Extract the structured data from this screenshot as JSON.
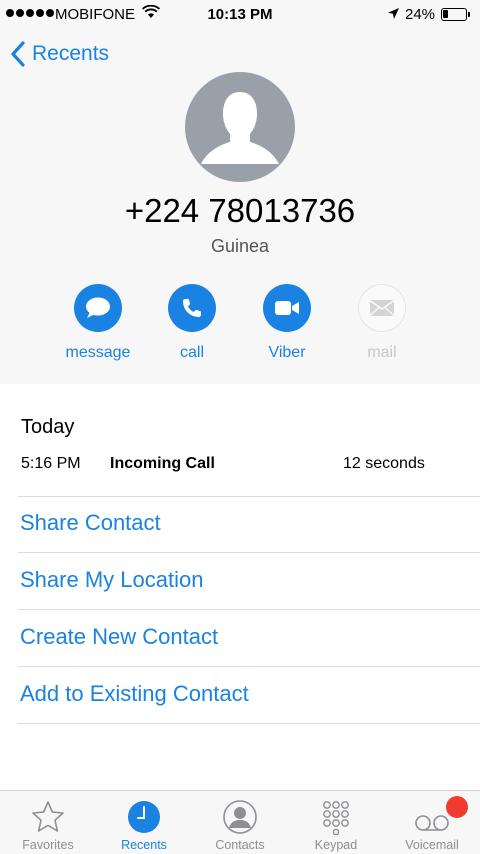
{
  "status_bar": {
    "carrier": "MOBIFONE",
    "time": "10:13 PM",
    "battery": "24%",
    "battery_level": 0.24
  },
  "nav": {
    "back_label": "Recents"
  },
  "contact": {
    "number": "+224 78013736",
    "country": "Guinea"
  },
  "actions": [
    {
      "label": "message",
      "icon": "message-bubble-icon",
      "enabled": true
    },
    {
      "label": "call",
      "icon": "phone-icon",
      "enabled": true
    },
    {
      "label": "Viber",
      "icon": "video-camera-icon",
      "enabled": true
    },
    {
      "label": "mail",
      "icon": "envelope-icon",
      "enabled": false
    }
  ],
  "history": {
    "heading": "Today",
    "entries": [
      {
        "time": "5:16 PM",
        "type": "Incoming Call",
        "duration": "12 seconds"
      }
    ]
  },
  "options": [
    "Share Contact",
    "Share My Location",
    "Create New Contact",
    "Add to Existing Contact"
  ],
  "tabs": [
    {
      "label": "Favorites",
      "icon": "star-icon",
      "active": false
    },
    {
      "label": "Recents",
      "icon": "clock-icon",
      "active": true
    },
    {
      "label": "Contacts",
      "icon": "person-circle-icon",
      "active": false
    },
    {
      "label": "Keypad",
      "icon": "keypad-icon",
      "active": false
    },
    {
      "label": "Voicemail",
      "icon": "voicemail-icon",
      "active": false
    }
  ],
  "colors": {
    "accent": "#1a82e2",
    "badge": "#f23a2e",
    "avatar_bg": "#9aa0a9",
    "inactive_tab": "#8e8e93"
  }
}
